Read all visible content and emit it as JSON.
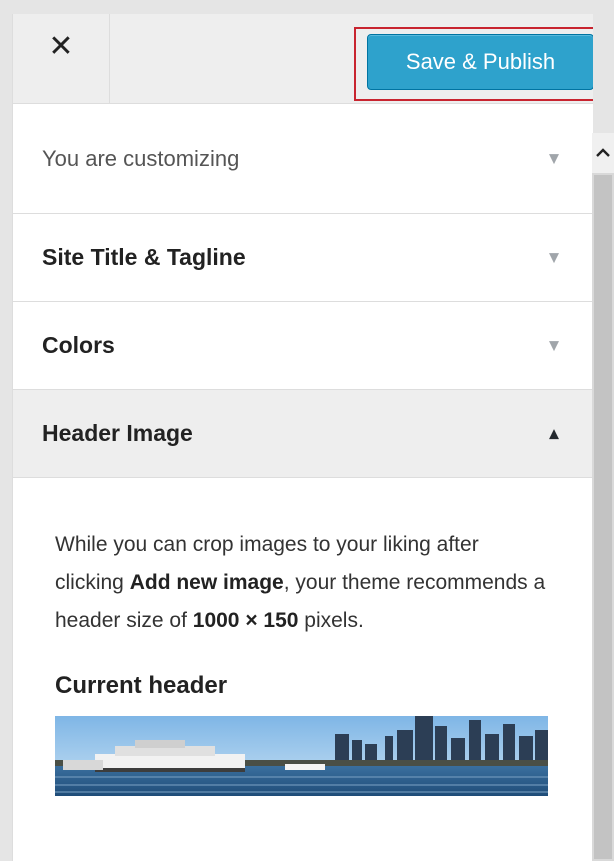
{
  "toolbar": {
    "close_glyph": "✕",
    "save_label": "Save & Publish",
    "highlight_color": "#c8242f",
    "button_color": "#2ea2cc"
  },
  "sections": [
    {
      "label": "You are customizing",
      "arrow": "▼"
    },
    {
      "label": "Site Title & Tagline",
      "arrow": "▼"
    },
    {
      "label": "Colors",
      "arrow": "▼"
    },
    {
      "label": "Header Image",
      "arrow": "▲"
    }
  ],
  "header_image": {
    "desc_part1": "While you can crop images to your liking after clicking ",
    "desc_bold1": "Add new image",
    "desc_part2": ", your theme recommends a header size of ",
    "desc_bold2": "1000 × 150",
    "desc_part3": " pixels.",
    "current_header_title": "Current header",
    "image_icon": "city-waterfront-image"
  },
  "scrollbar": {
    "up_icon": "chevron-up-icon"
  }
}
